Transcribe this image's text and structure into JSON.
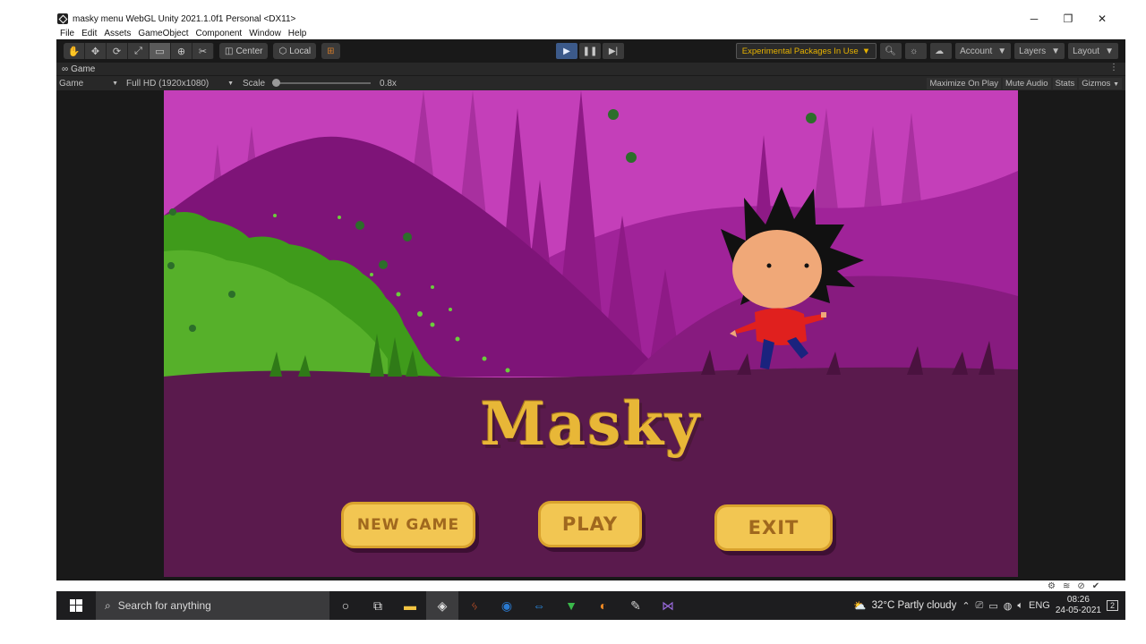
{
  "window": {
    "title": "masky  menu  WebGL  Unity 2021.1.0f1 Personal <DX11>",
    "minimize": "─",
    "restore": "❐",
    "close": "✕"
  },
  "menu": [
    "File",
    "Edit",
    "Assets",
    "GameObject",
    "Component",
    "Window",
    "Help"
  ],
  "toolbar": {
    "pivot": "Center",
    "space": "Local",
    "experimental": "Experimental Packages In Use",
    "account": "Account",
    "layers": "Layers",
    "layout": "Layout"
  },
  "game_tab": {
    "label": "Game",
    "display": "Game",
    "resolution": "Full HD (1920x1080)",
    "scale_label": "Scale",
    "scale_value": "0.8x",
    "scale_fraction": 0.0,
    "maximize": "Maximize On Play",
    "mute": "Mute Audio",
    "stats": "Stats",
    "gizmos": "Gizmos"
  },
  "game": {
    "title": "Masky",
    "buttons": [
      "NEW GAME",
      "PLAY",
      "EXIT"
    ],
    "colors": {
      "sky": "#c43fb9",
      "ground": "#5a1a4d",
      "bush": "#3f9b1b",
      "title": "#e8b737",
      "button": "#f2c652"
    }
  },
  "taskbar": {
    "search_placeholder": "Search for anything",
    "weather": "32°C  Partly cloudy",
    "lang": "ENG",
    "time": "08:26",
    "date": "24-05-2021",
    "notifications": "2"
  }
}
